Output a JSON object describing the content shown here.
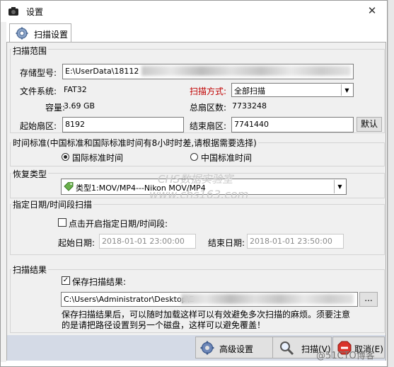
{
  "window": {
    "title": "设置"
  },
  "tab": {
    "label": "扫描设置"
  },
  "scan_range": {
    "group_title": "扫描范围",
    "storage_label": "存储型号:",
    "storage_value": "E:\\UserData\\18112",
    "fs_label": "文件系统:",
    "fs_value": "FAT32",
    "scan_method_label": "扫描方式:",
    "scan_method_value": "全部扫描",
    "capacity_label": "容量:",
    "capacity_value": "3.69 GB",
    "total_sectors_label": "总扇区数:",
    "total_sectors_value": "7733248",
    "start_sector_label": "起始扇区:",
    "start_sector_value": "8192",
    "end_sector_label": "结束扇区:",
    "end_sector_value": "7741440",
    "default_button": "默认"
  },
  "time_standard": {
    "group_title": "时间标准(中国标准和国际标准时间有8小时时差,请根据需要选择)",
    "option_intl": "国际标准时间",
    "option_china": "中国标准时间",
    "selected": "国际标准时间"
  },
  "recovery_type": {
    "group_title": "恢复类型",
    "value": "类型1:MOV/MP4---Nikon MOV/MP4"
  },
  "date_scan": {
    "group_title": "指定日期/时间段扫描",
    "checkbox_label": "点击开启指定日期/时间段:",
    "checked": false,
    "start_label": "起始日期:",
    "start_value": "2018-01-01 23:00:00",
    "end_label": "结束日期:",
    "end_value": "2018-01-01 23:50:00"
  },
  "scan_result": {
    "group_title": "扫描结果",
    "checkbox_label": "保存扫描结果:",
    "checked": true,
    "path_value": "C:\\Users\\Administrator\\Desktop\\E",
    "browse_button": "...",
    "note": "保存扫描结果后，可以随时加载这样可以有效避免多次扫描的麻烦。须要注意的是请把路径设置到另一个磁盘，这样可以避免覆盖！"
  },
  "buttons": {
    "advanced": "高级设置",
    "scan": "扫描(V)",
    "cancel": "取消(E)"
  },
  "watermarks": {
    "brand": "CHS数据实验室",
    "url": "www.chs163.com",
    "blog": "@51CTO博客"
  },
  "colors": {
    "accent_red": "#c00000",
    "bottom_bar": "#d4dae6"
  }
}
